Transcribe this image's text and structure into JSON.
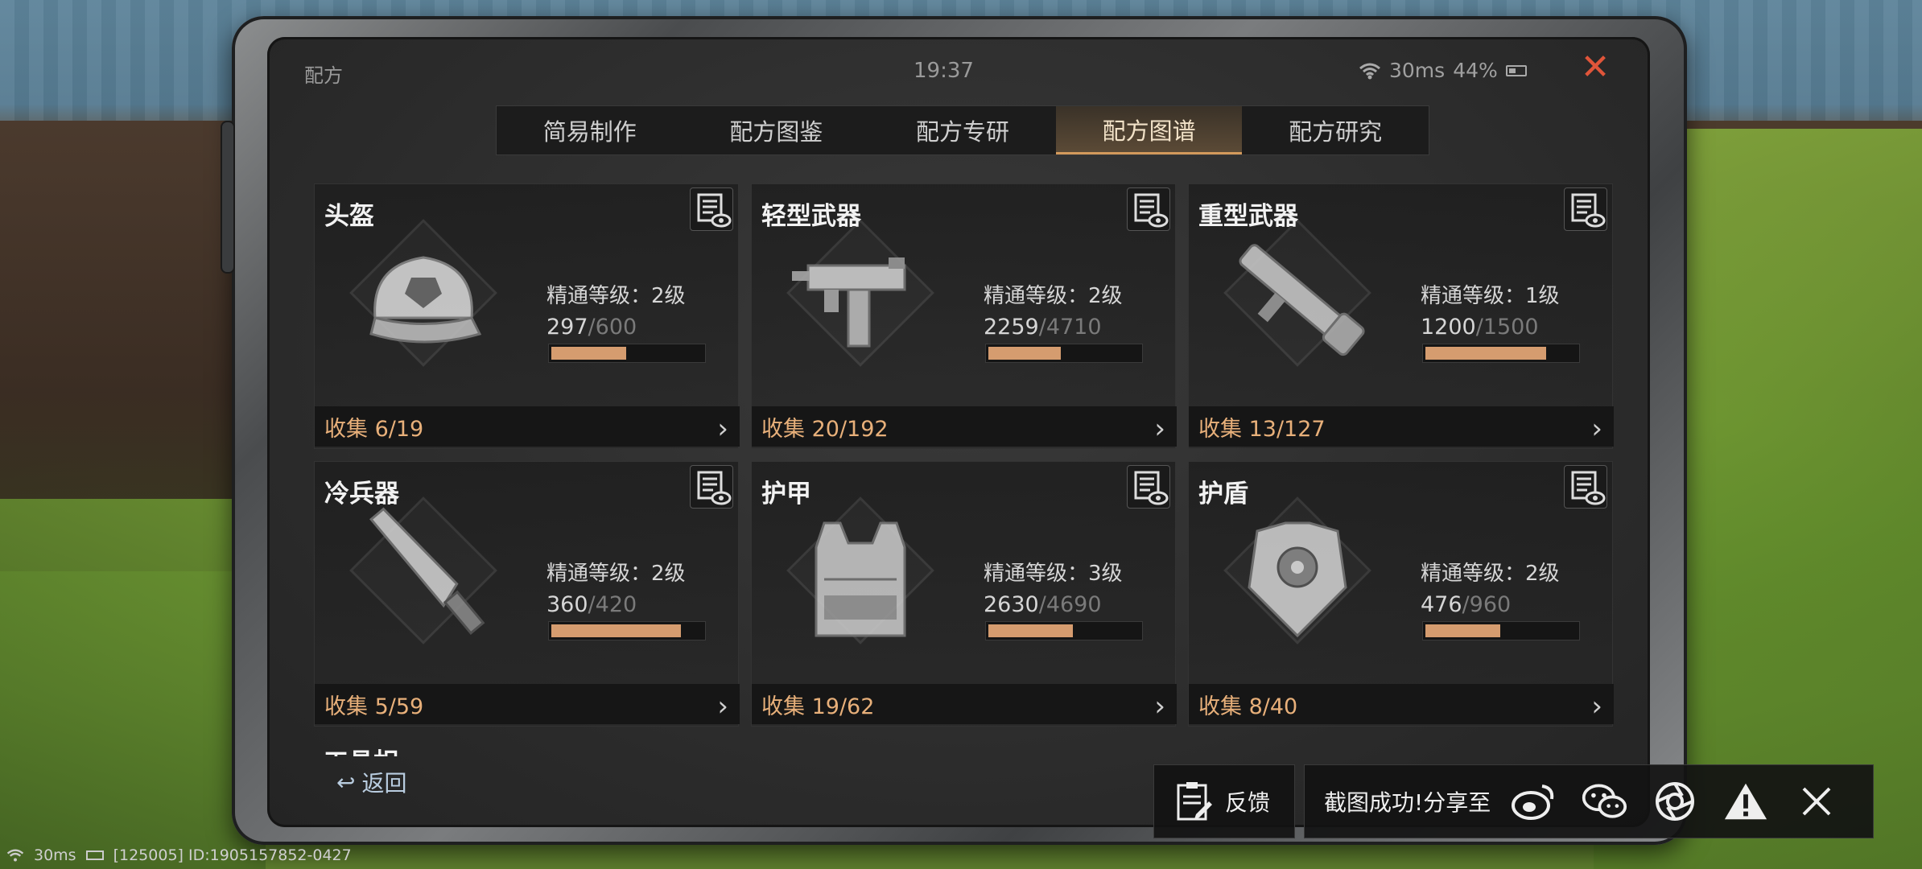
{
  "status": {
    "title": "配方",
    "time": "19:37",
    "ping": "30ms",
    "battery": "44%"
  },
  "tabs": [
    {
      "label": "简易制作",
      "active": false
    },
    {
      "label": "配方图鉴",
      "active": false
    },
    {
      "label": "配方专研",
      "active": false
    },
    {
      "label": "配方图谱",
      "active": true
    },
    {
      "label": "配方研究",
      "active": false
    }
  ],
  "cards": [
    {
      "title": "头盔",
      "mastery": "精通等级：2级",
      "current": "297",
      "max": "/600",
      "progress": 0.495,
      "collect": "收集 6/19",
      "icon": "cap-icon"
    },
    {
      "title": "轻型武器",
      "mastery": "精通等级：2级",
      "current": "2259",
      "max": "/4710",
      "progress": 0.48,
      "collect": "收集 20/192",
      "icon": "smg-icon"
    },
    {
      "title": "重型武器",
      "mastery": "精通等级：1级",
      "current": "1200",
      "max": "/1500",
      "progress": 0.8,
      "collect": "收集 13/127",
      "icon": "rocket-launcher-icon"
    },
    {
      "title": "冷兵器",
      "mastery": "精通等级：2级",
      "current": "360",
      "max": "/420",
      "progress": 0.857,
      "collect": "收集 5/59",
      "icon": "machete-icon"
    },
    {
      "title": "护甲",
      "mastery": "精通等级：3级",
      "current": "2630",
      "max": "/4690",
      "progress": 0.56,
      "collect": "收集 19/62",
      "icon": "vest-icon"
    },
    {
      "title": "护盾",
      "mastery": "精通等级：2级",
      "current": "476",
      "max": "/960",
      "progress": 0.496,
      "collect": "收集 8/40",
      "icon": "shield-armor-icon"
    }
  ],
  "partial_card_title": "工具相",
  "back_label": "返回",
  "feedback_label": "反馈",
  "share_label": "截图成功!分享至",
  "footer": {
    "ping": "30ms",
    "ids": "[125005] ID:1905157852-0427"
  },
  "colors": {
    "accent": "#d59c6f",
    "collect_text": "#e8b07a",
    "close": "#e0553a"
  }
}
